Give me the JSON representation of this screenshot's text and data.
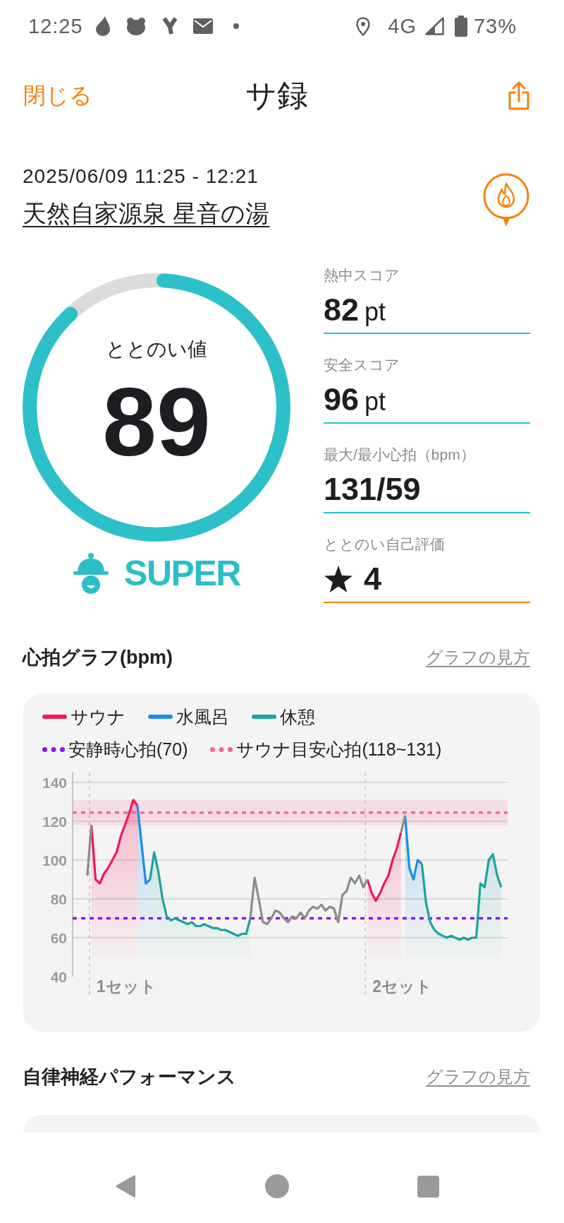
{
  "status_bar": {
    "time": "12:25",
    "network": "4G",
    "battery": "73%"
  },
  "header": {
    "close": "閉じる",
    "title": "サ録"
  },
  "visit": {
    "datetime": "2025/06/09 11:25 - 12:21",
    "place": "天然自家源泉 星音の湯"
  },
  "score": {
    "label": "ととのい値",
    "value": "89",
    "level": 0.89,
    "rank": "SUPER"
  },
  "stats": [
    {
      "kind": "score",
      "label": "熱中スコア",
      "value": "82",
      "unit": "pt"
    },
    {
      "kind": "score",
      "label": "安全スコア",
      "value": "96",
      "unit": "pt"
    },
    {
      "kind": "score",
      "label": "最大/最小心拍（bpm）",
      "value": "131/59"
    },
    {
      "kind": "rating",
      "label": "ととのい自己評価",
      "value": "4"
    }
  ],
  "heart_rate_graph": {
    "title": "心拍グラフ(bpm)",
    "link": "グラフの見方",
    "chart_data": {
      "type": "area",
      "legend": "top",
      "grid": true,
      "ylim": [
        40,
        140
      ],
      "yticks": [
        40,
        60,
        80,
        100,
        120,
        140
      ],
      "series": [
        {
          "name": "サウナ",
          "color": "#f0185a",
          "values": [
            null,
            null,
            null,
            null,
            118,
            90,
            88,
            93,
            96,
            100,
            104,
            112,
            118,
            124,
            131,
            128,
            null,
            null,
            null,
            null,
            null,
            null,
            null,
            null,
            null,
            null,
            null,
            null,
            null,
            null,
            null,
            null,
            null,
            null,
            null,
            null,
            null,
            null,
            null,
            null,
            null,
            null,
            null,
            null,
            null,
            null,
            null,
            null,
            null,
            null,
            null,
            null,
            null,
            null,
            null,
            null,
            null,
            null,
            null,
            null,
            null,
            null,
            null,
            null,
            null,
            null,
            null,
            null,
            null,
            null,
            90,
            83,
            79,
            83,
            88,
            92,
            100,
            106,
            114,
            null,
            null,
            null,
            null,
            null,
            null,
            null,
            null,
            null,
            null,
            null,
            null,
            null,
            null,
            null,
            null,
            null,
            null,
            null,
            null,
            null,
            null,
            null,
            null,
            null
          ]
        },
        {
          "name": "水風呂",
          "color": "#1a8de8",
          "values": [
            null,
            null,
            null,
            null,
            null,
            null,
            null,
            null,
            null,
            null,
            null,
            null,
            null,
            null,
            null,
            128,
            108,
            88,
            90,
            null,
            null,
            null,
            null,
            null,
            null,
            null,
            null,
            null,
            null,
            null,
            null,
            null,
            null,
            null,
            null,
            null,
            null,
            null,
            null,
            null,
            null,
            null,
            null,
            null,
            null,
            null,
            null,
            null,
            null,
            null,
            null,
            null,
            null,
            null,
            null,
            null,
            null,
            null,
            null,
            null,
            null,
            null,
            null,
            null,
            null,
            null,
            null,
            null,
            null,
            null,
            null,
            null,
            null,
            null,
            null,
            null,
            null,
            null,
            null,
            123,
            96,
            90,
            100,
            98,
            null,
            null,
            null,
            null,
            null,
            null,
            null,
            null,
            null,
            null,
            null,
            null,
            null,
            null,
            null,
            null,
            null,
            null,
            null
          ]
        },
        {
          "name": "休憩",
          "color": "#18a59f",
          "values": [
            null,
            null,
            null,
            null,
            null,
            null,
            null,
            null,
            null,
            null,
            null,
            null,
            null,
            null,
            null,
            null,
            null,
            null,
            90,
            104,
            94,
            80,
            71,
            69,
            70,
            69,
            68,
            67,
            68,
            66,
            66,
            67,
            66,
            65,
            65,
            64,
            64,
            63,
            62,
            61,
            62,
            62,
            70,
            null,
            null,
            null,
            null,
            null,
            null,
            null,
            null,
            null,
            null,
            null,
            null,
            null,
            null,
            null,
            null,
            null,
            null,
            null,
            null,
            null,
            null,
            null,
            null,
            null,
            null,
            null,
            null,
            null,
            null,
            null,
            null,
            null,
            null,
            null,
            null,
            null,
            null,
            null,
            null,
            98,
            78,
            68,
            64,
            62,
            61,
            60,
            61,
            60,
            59,
            60,
            59,
            60,
            60,
            88,
            86,
            100,
            103,
            92,
            86
          ]
        },
        {
          "type": "line",
          "color": "#8c8c8c",
          "values": [
            null,
            null,
            null,
            92,
            118,
            null,
            null,
            null,
            null,
            null,
            null,
            null,
            null,
            null,
            null,
            null,
            null,
            null,
            null,
            null,
            null,
            null,
            null,
            null,
            null,
            null,
            null,
            null,
            null,
            null,
            null,
            null,
            null,
            null,
            null,
            null,
            null,
            null,
            null,
            null,
            null,
            null,
            70,
            91,
            80,
            68,
            67,
            70,
            74,
            73,
            70,
            68,
            71,
            70,
            73,
            70,
            74,
            76,
            75,
            77,
            74,
            76,
            75,
            68,
            82,
            84,
            91,
            88,
            92,
            86,
            90,
            null,
            null,
            null,
            null,
            null,
            null,
            null,
            114,
            123,
            null,
            null,
            null,
            null,
            null,
            null,
            null,
            null,
            null,
            null,
            null,
            null,
            null,
            null,
            null,
            null,
            null,
            null,
            null,
            null,
            null,
            null,
            null
          ]
        }
      ],
      "ref_lines": [
        {
          "axis": "y",
          "value": 70,
          "label": "安静時心拍(70)",
          "color": "#8b17f0"
        },
        {
          "axis": "y",
          "value": 124.5,
          "label": "サウナ目安心拍(118~131)",
          "color": "#f2679a"
        }
      ],
      "bands": [
        {
          "axis": "y",
          "from": 118,
          "to": 131,
          "color": "#f2679a"
        }
      ],
      "annotations": [
        "1セット",
        "2セット"
      ]
    }
  },
  "autonomic_section": {
    "title": "自律神経パフォーマンス",
    "link": "グラフの見方"
  }
}
